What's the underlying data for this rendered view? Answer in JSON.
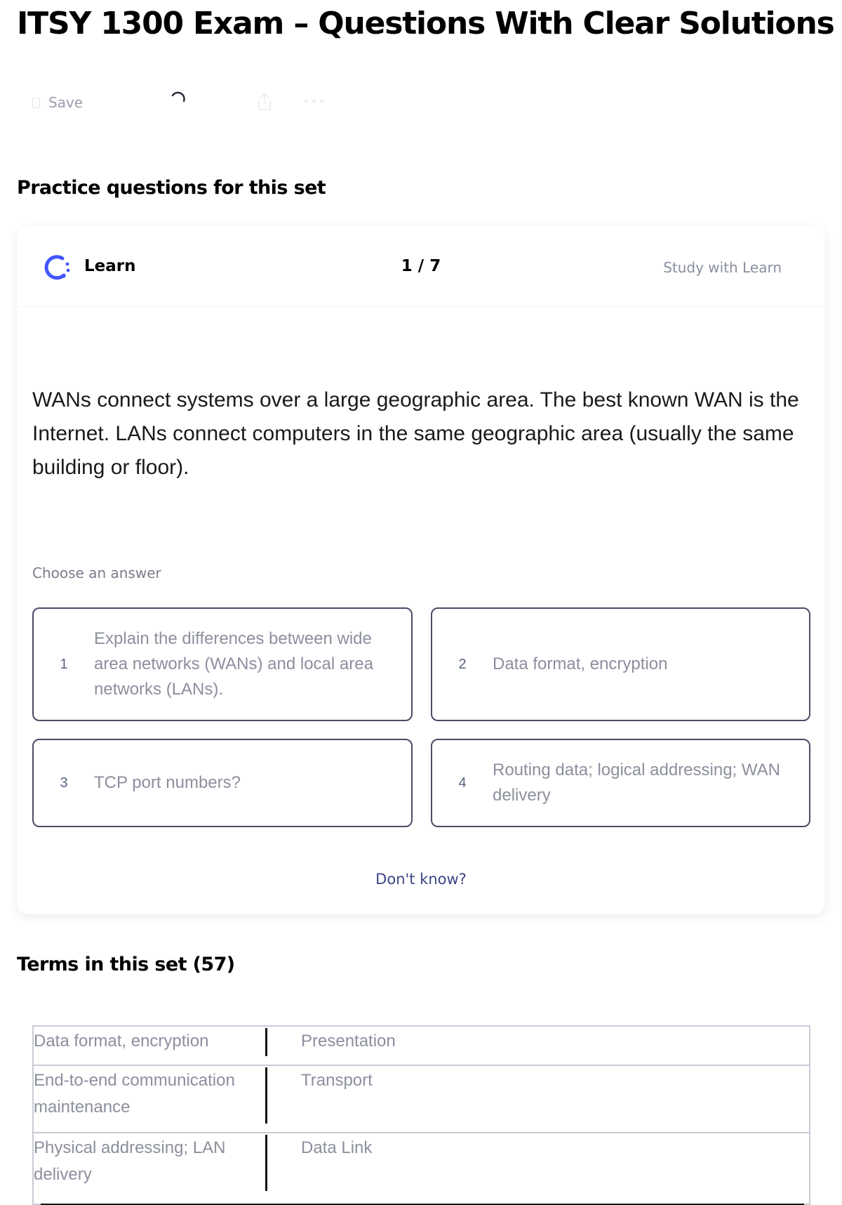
{
  "page": {
    "title": "ITSY 1300 Exam – Questions With Clear Solutions"
  },
  "toolbar": {
    "save_label": "Save",
    "icons": [
      "bookmark-icon",
      "loading-spinner-icon",
      "share-icon",
      "more-icon"
    ]
  },
  "practice": {
    "section_title": "Practice questions for this set",
    "learn_label": "Learn",
    "progress": "1 / 7",
    "study_link": "Study with Learn",
    "question": "WANs connect systems over a large geographic area. The best known WAN is the Internet. LANs connect computers in the same geographic area (usually the same building or floor).",
    "choose_label": "Choose an answer",
    "options": [
      {
        "num": "1",
        "text": "Explain the differences between wide area networks (WANs) and local area networks (LANs)."
      },
      {
        "num": "2",
        "text": "Data format, encryption"
      },
      {
        "num": "3",
        "text": "TCP port numbers?"
      },
      {
        "num": "4",
        "text": "Routing data; logical addressing; WAN delivery"
      }
    ],
    "dont_know": "Don't know?"
  },
  "terms": {
    "section_title": "Terms in this set (57)",
    "rows": [
      {
        "term": "Data format, encryption",
        "definition": "Presentation"
      },
      {
        "term": "End-to-end communication maintenance",
        "definition": "Transport"
      },
      {
        "term": "Physical addressing; LAN delivery",
        "definition": "Data Link"
      }
    ]
  },
  "colors": {
    "learn_icon": "#4255ff",
    "option_border": "#4a4d66",
    "dont_know": "#3b4485"
  }
}
